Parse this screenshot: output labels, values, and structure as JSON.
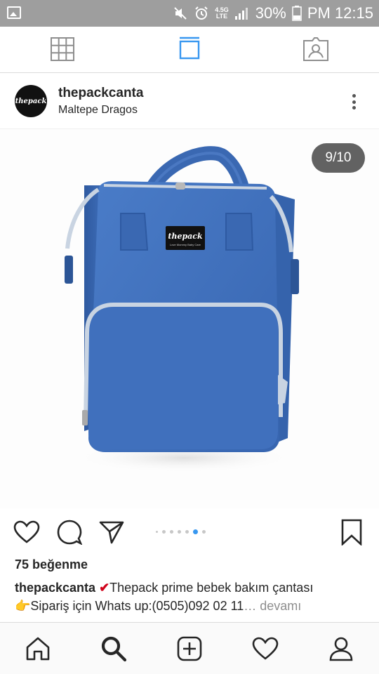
{
  "status_bar": {
    "battery": "30%",
    "time": "PM 12:15",
    "network_top": "4.5G",
    "network_bottom": "LTE",
    "icons": [
      "image-icon",
      "mute-icon",
      "alarm-icon",
      "signal-icon",
      "battery-icon"
    ]
  },
  "view_tabs": {
    "active": "feed",
    "icons": [
      "grid-icon",
      "feed-icon",
      "tagged-icon"
    ],
    "accent": "#3897f0"
  },
  "post": {
    "avatar_text": "thepack",
    "username": "thepackcanta",
    "location": "Maltepe Dragos",
    "counter": "9/10",
    "bag_label": "thepack",
    "bag_label_sub": "Love Mommy Baby Care",
    "bag_color": "#3f6fbb",
    "carousel": {
      "dots_total": 7,
      "active_index": 5
    },
    "likes": "75 beğenme",
    "caption": {
      "user": "thepackcanta",
      "check": "✔",
      "text1": "Thepack prime bebek bakım çantası",
      "hand": "👉",
      "text2": "Sipariş için Whats up:(0505)092 02 11",
      "more": "… devamı"
    }
  },
  "bottom_nav": {
    "items": [
      "home-icon",
      "search-icon",
      "add-post-icon",
      "activity-icon",
      "profile-icon"
    ]
  }
}
